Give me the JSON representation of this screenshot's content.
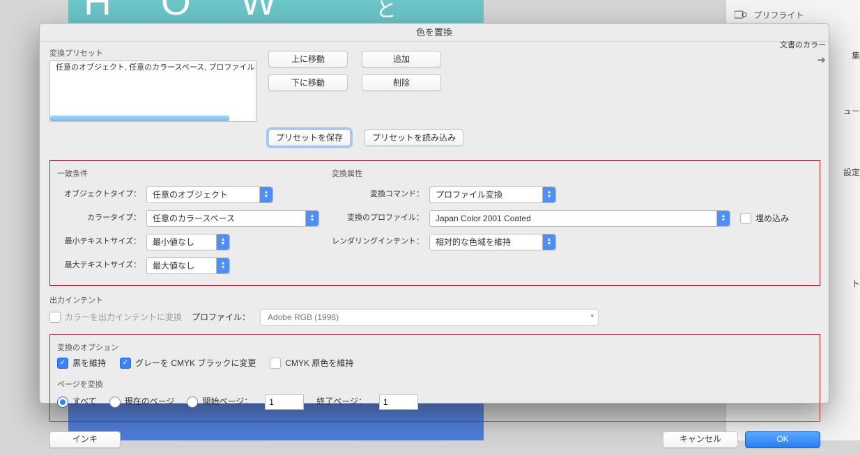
{
  "sidebar": {
    "preflight": "プリフライト",
    "edge1": "集",
    "edge2": "ュー",
    "edge3": "設定",
    "edge4": "ト"
  },
  "bg": {
    "how": "H O W",
    "jp": "と"
  },
  "dialog": {
    "title": "色を置換",
    "preset_section": "変換プリセット",
    "preset_item": "任意のオブジェクト, 任意のカラースペース, プロファイル",
    "move_up": "上に移動",
    "move_down": "下に移動",
    "add": "追加",
    "delete": "削除",
    "save_preset": "プリセットを保存",
    "load_preset": "プリセットを読み込み",
    "doc_colors": "文書のカラー"
  },
  "match": {
    "title": "一致条件",
    "obj_type_lbl": "オブジェクトタイプ：",
    "obj_type_val": "任意のオブジェクト",
    "color_type_lbl": "カラータイプ：",
    "color_type_val": "任意のカラースペース",
    "min_text_lbl": "最小テキストサイズ：",
    "min_text_val": "最小値なし",
    "max_text_lbl": "最大テキストサイズ：",
    "max_text_val": "最大値なし"
  },
  "conv": {
    "title": "変換属性",
    "cmd_lbl": "変換コマンド：",
    "cmd_val": "プロファイル変換",
    "profile_lbl": "変換のプロファイル：",
    "profile_val": "Japan Color 2001 Coated",
    "embed": "埋め込み",
    "intent_lbl": "レンダリングインテント：",
    "intent_val": "相対的な色域を維持"
  },
  "oi": {
    "title": "出力インテント",
    "check_label": "カラーを出力インテントに変換",
    "profile_lbl": "プロファイル：",
    "profile_val": "Adobe RGB (1998)"
  },
  "opts": {
    "title": "変換のオプション",
    "keep_black": "黒を維持",
    "gray_to_cmyk": "グレーを CMYK ブラックに変更",
    "cmyk_primary": "CMYK 原色を維持",
    "pages_title": "ページを変換",
    "all": "すべて",
    "current": "現在のページ",
    "start_lbl": "開始ページ：",
    "start_val": "1",
    "end_lbl": "終了ページ：",
    "end_val": "1"
  },
  "footer": {
    "ink": "インキ",
    "cancel": "キャンセル",
    "ok": "OK"
  }
}
